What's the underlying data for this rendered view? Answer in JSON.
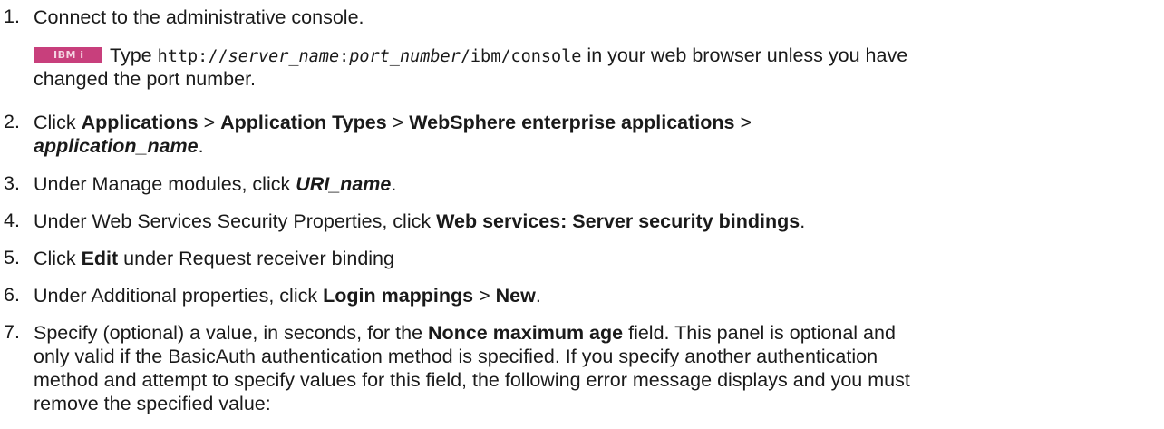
{
  "steps": [
    {
      "num": "1.",
      "text": "Connect to the administrative console.",
      "note": {
        "badge": "IBM i",
        "pre": "Type",
        "url_a": "http://",
        "url_server": "server_name",
        "url_colon": ":",
        "url_port": "port_number",
        "url_path": "/ibm/console",
        "post": "in your web browser unless you have",
        "post2": "changed the port number."
      }
    },
    {
      "num": "2.",
      "pre": "Click",
      "b1": "Applications",
      "sep1": ">",
      "b2": "Application Types",
      "sep2": ">",
      "b3": "WebSphere enterprise applications",
      "sep3": ">",
      "bi": "application_name",
      "end": "."
    },
    {
      "num": "3.",
      "pre": "Under Manage modules, click",
      "bi": "URI_name",
      "end": "."
    },
    {
      "num": "4.",
      "pre": "Under Web Services Security Properties, click",
      "b": "Web services: Server security bindings",
      "end": "."
    },
    {
      "num": "5.",
      "pre": "Click",
      "b": "Edit",
      "post": "under Request receiver binding"
    },
    {
      "num": "6.",
      "pre": "Under Additional properties, click",
      "b1": "Login mappings",
      "sep": ">",
      "b2": "New",
      "end": "."
    },
    {
      "num": "7.",
      "pre": "Specify (optional) a value, in seconds, for the",
      "b": "Nonce maximum age",
      "post": "field. This panel is optional and",
      "line2": "only valid if the BasicAuth authentication method is specified. If you specify another authentication",
      "line3": "method and attempt to specify values for this field, the following error message displays and you must",
      "line4": "remove the specified value:"
    }
  ]
}
